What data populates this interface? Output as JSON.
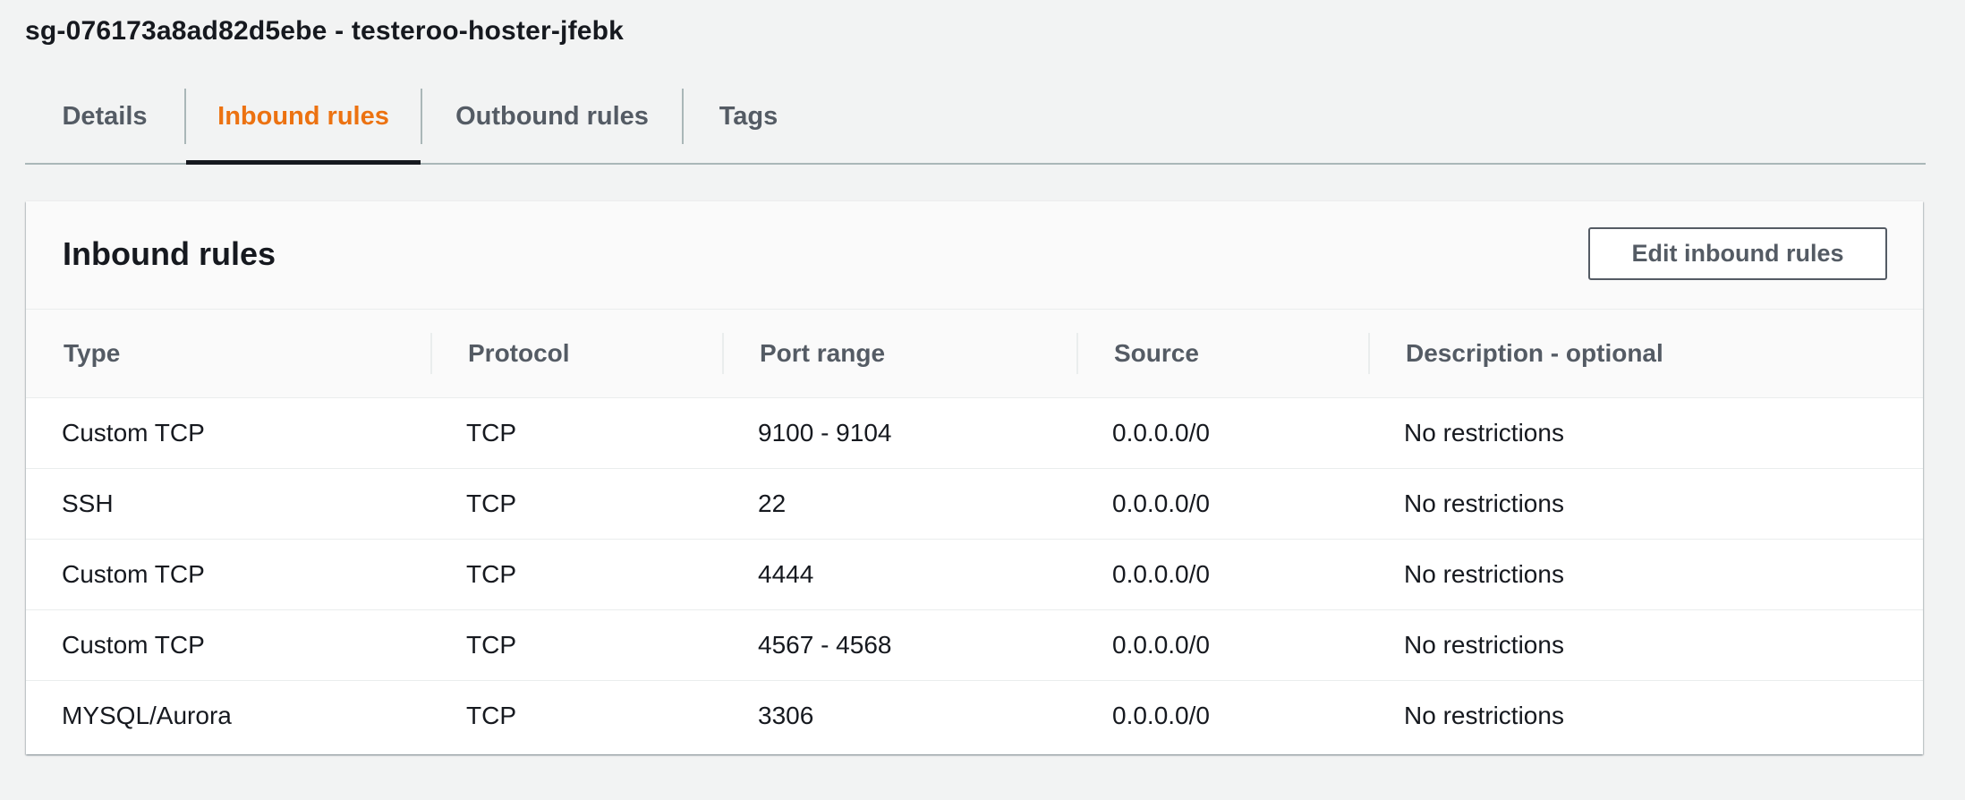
{
  "page": {
    "title": "sg-076173a8ad82d5ebe - testeroo-hoster-jfebk"
  },
  "tabs": [
    {
      "label": "Details",
      "active": false
    },
    {
      "label": "Inbound rules",
      "active": true
    },
    {
      "label": "Outbound rules",
      "active": false
    },
    {
      "label": "Tags",
      "active": false
    }
  ],
  "panel": {
    "title": "Inbound rules",
    "edit_button_label": "Edit inbound rules"
  },
  "table": {
    "columns": [
      "Type",
      "Protocol",
      "Port range",
      "Source",
      "Description - optional"
    ],
    "rows": [
      [
        "Custom TCP",
        "TCP",
        "9100 - 9104",
        "0.0.0.0/0",
        "No restrictions"
      ],
      [
        "SSH",
        "TCP",
        "22",
        "0.0.0.0/0",
        "No restrictions"
      ],
      [
        "Custom TCP",
        "TCP",
        "4444",
        "0.0.0.0/0",
        "No restrictions"
      ],
      [
        "Custom TCP",
        "TCP",
        "4567 - 4568",
        "0.0.0.0/0",
        "No restrictions"
      ],
      [
        "MYSQL/Aurora",
        "TCP",
        "3306",
        "0.0.0.0/0",
        "No restrictions"
      ]
    ]
  },
  "colors": {
    "accent": "#ec7211",
    "tab_text": "#545b64",
    "text": "#16191f",
    "background": "#f2f3f3"
  }
}
